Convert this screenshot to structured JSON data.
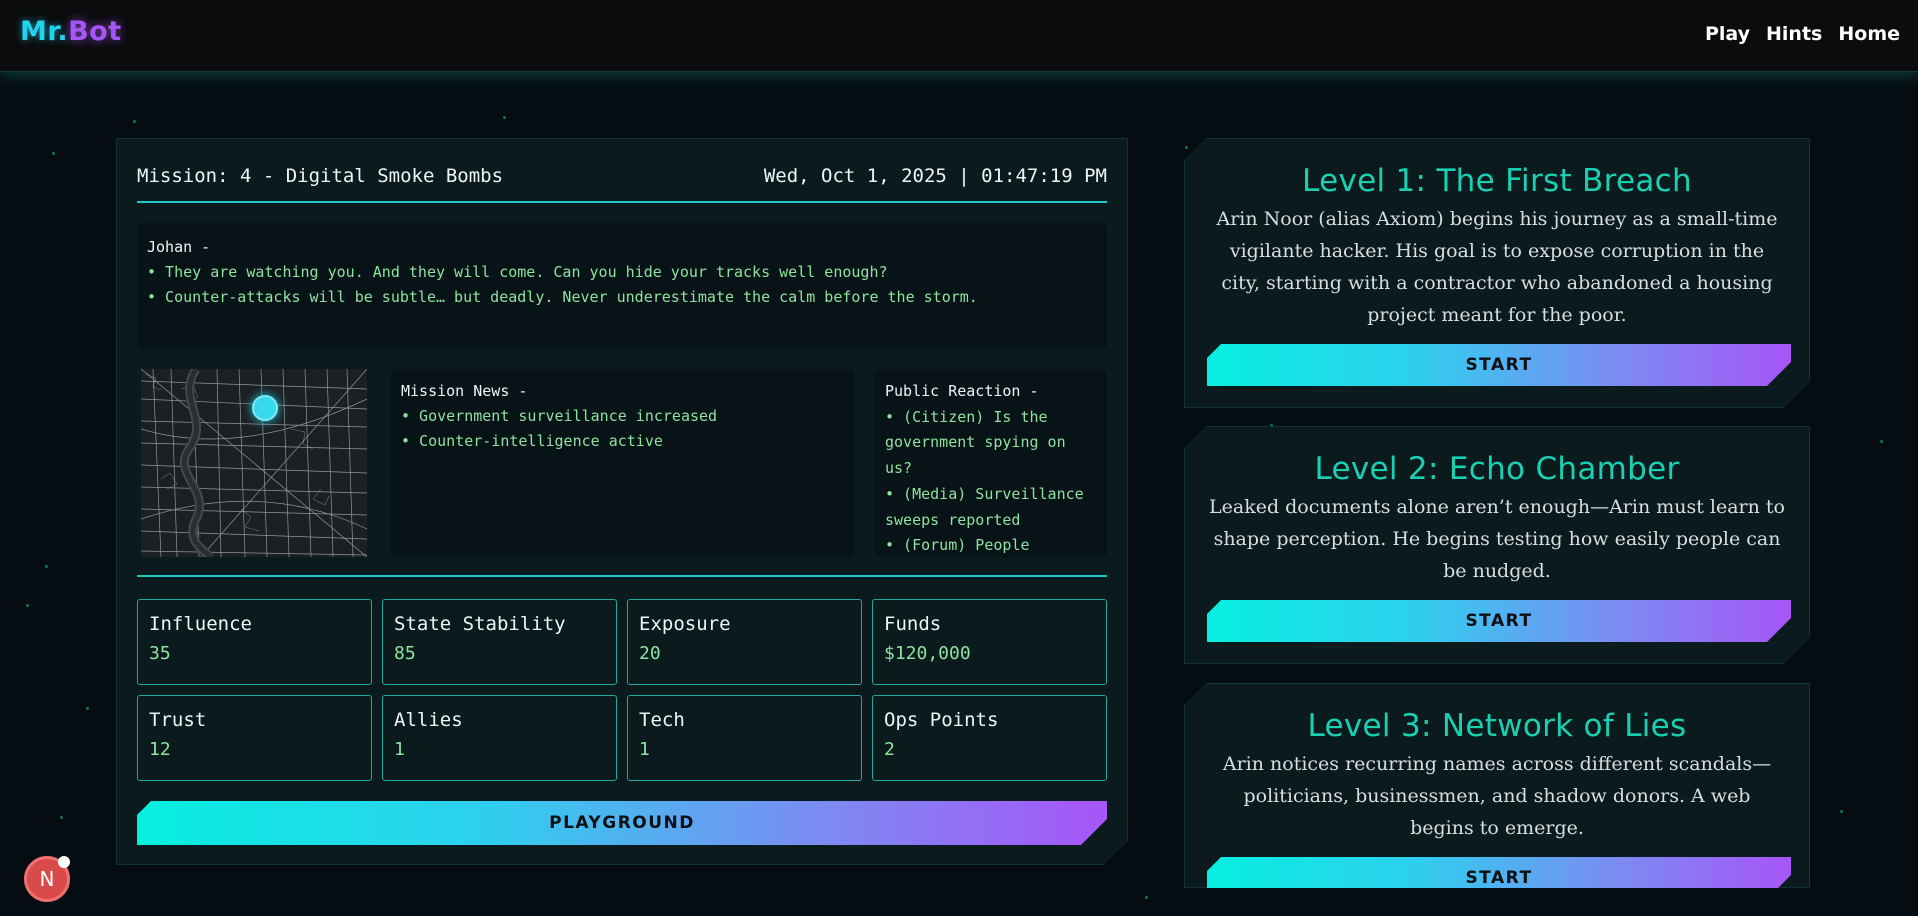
{
  "header": {
    "logo_part1": "Mr.",
    "logo_part2": "Bot",
    "nav": [
      "Play",
      "Hints",
      "Home"
    ]
  },
  "mission": {
    "title": "Mission: 4 - Digital Smoke Bombs",
    "datetime": "Wed, Oct 1, 2025 | 01:47:19 PM",
    "briefing": {
      "speaker": "Johan -",
      "lines": [
        "• They are watching you. And they will come. Can you hide your tracks well enough?",
        "• Counter-attacks will be subtle… but deadly. Never underestimate the calm before the storm."
      ]
    },
    "news": {
      "title": "Mission News -",
      "items": [
        "• Government surveillance increased",
        "• Counter-intelligence active"
      ]
    },
    "reaction": {
      "title": "Public Reaction -",
      "items": [
        "• (Citizen) Is the government spying on us?",
        "• (Media) Surveillance sweeps reported",
        "• (Forum) People"
      ]
    },
    "stats": [
      {
        "label": "Influence",
        "value": "35"
      },
      {
        "label": "State Stability",
        "value": "85"
      },
      {
        "label": "Exposure",
        "value": "20"
      },
      {
        "label": "Funds",
        "value": "$120,000"
      },
      {
        "label": "Trust",
        "value": "12"
      },
      {
        "label": "Allies",
        "value": "1"
      },
      {
        "label": "Tech",
        "value": "1"
      },
      {
        "label": "Ops Points",
        "value": "2"
      }
    ],
    "playground_label": "PLAYGROUND"
  },
  "levels": [
    {
      "title": "Level 1: The First Breach",
      "description": "Arin Noor (alias Axiom) begins his journey as a small-time vigilante hacker. His goal is to expose corruption in the city, starting with a contractor who abandoned a housing project meant for the poor.",
      "button": "START"
    },
    {
      "title": "Level 2: Echo Chamber",
      "description": "Leaked documents alone aren’t enough—Arin must learn to shape perception. He begins testing how easily people can be nudged.",
      "button": "START"
    },
    {
      "title": "Level 3: Network of Lies",
      "description": "Arin notices recurring names across different scandals—politicians, businessmen, and shadow donors. A web begins to emerge.",
      "button": "START"
    }
  ],
  "badge": {
    "letter": "N"
  },
  "colors": {
    "accent_cyan": "#22d3ee",
    "accent_purple": "#a855f7",
    "level_title": "#19d1b2",
    "stat_value": "#8fe39f"
  },
  "icons": [
    "map-marker-icon",
    "next-badge-icon"
  ]
}
